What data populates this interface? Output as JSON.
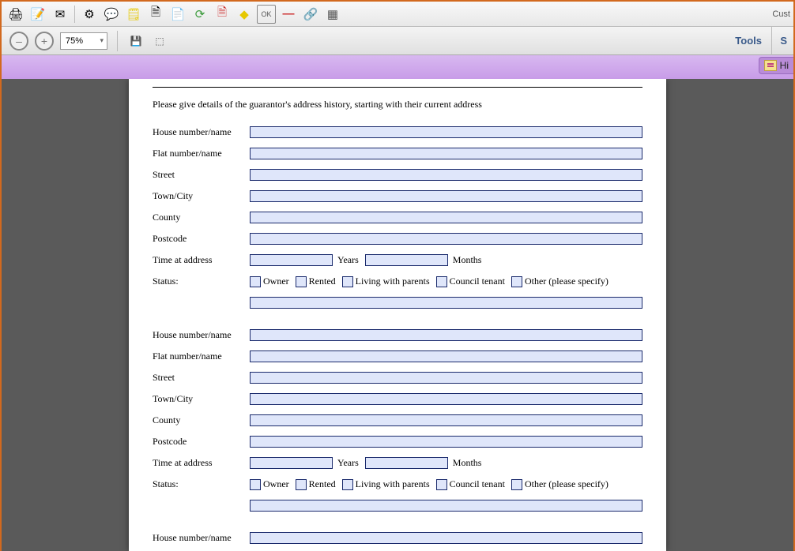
{
  "toolbar": {
    "customize": "Cust",
    "icons": [
      {
        "name": "print-icon",
        "glyph": "🖨"
      },
      {
        "name": "edit-icon",
        "glyph": "📝"
      },
      {
        "name": "mail-icon",
        "glyph": "✉"
      },
      {
        "name": "gear-icon",
        "glyph": "⚙"
      },
      {
        "name": "comment-icon",
        "glyph": "💬"
      },
      {
        "name": "sticky-note-icon",
        "glyph": "📋"
      },
      {
        "name": "delete-page-icon",
        "glyph": "❌"
      },
      {
        "name": "pages-icon",
        "glyph": "📄"
      },
      {
        "name": "refresh-icon",
        "glyph": "🔄"
      },
      {
        "name": "edit-form-icon",
        "glyph": "📝"
      },
      {
        "name": "diamond-icon",
        "glyph": "◆"
      },
      {
        "name": "ok-icon",
        "glyph": "OK"
      },
      {
        "name": "minus-icon",
        "glyph": "—"
      },
      {
        "name": "link-icon",
        "glyph": "🔗"
      },
      {
        "name": "table-icon",
        "glyph": "▦"
      }
    ]
  },
  "subbar": {
    "zoom": "75%",
    "tools": "Tools",
    "s": "S"
  },
  "sidetab": {
    "label": "Hi"
  },
  "form": {
    "intro": "Please give details of the guarantor's address history, starting with their current address",
    "labels": {
      "house": "House number/name",
      "flat": "Flat number/name",
      "street": "Street",
      "town": "Town/City",
      "county": "County",
      "postcode": "Postcode",
      "time": "Time at address",
      "years": "Years",
      "months": "Months",
      "status": "Status:",
      "owner": "Owner",
      "rented": "Rented",
      "living": "Living with parents",
      "council": "Council tenant",
      "other": "Other (please specify)"
    }
  }
}
